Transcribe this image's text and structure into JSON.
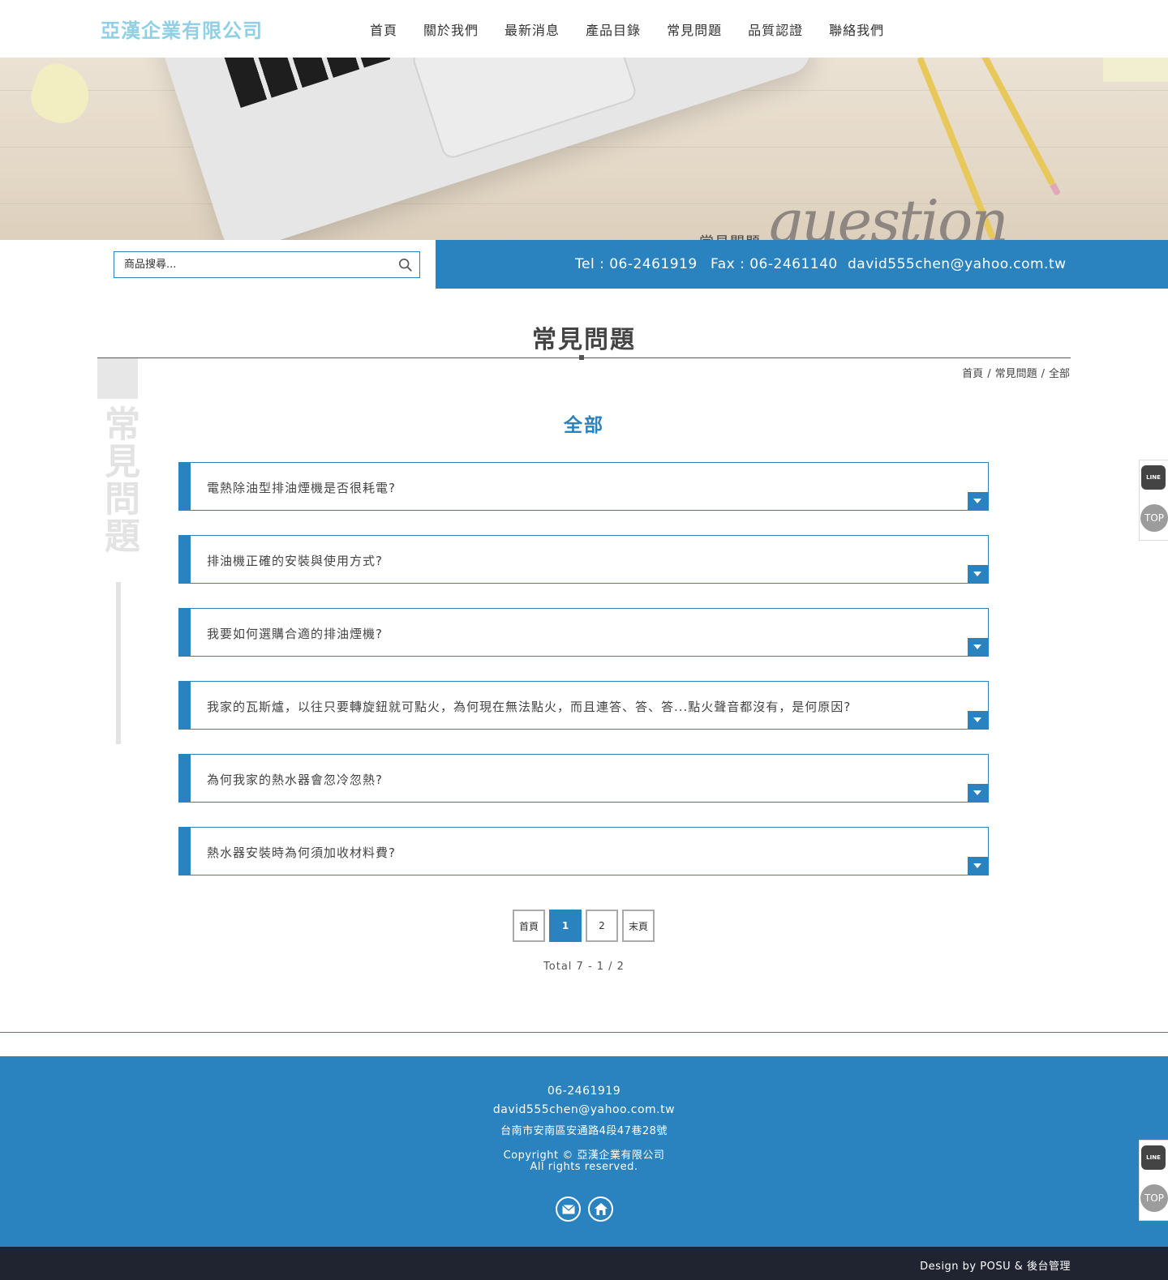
{
  "header": {
    "logo": "亞漢企業有限公司",
    "nav": [
      "首頁",
      "關於我們",
      "最新消息",
      "產品目錄",
      "常見問題",
      "品質認證",
      "聯絡我們"
    ]
  },
  "banner": {
    "title_zh": "常見問題",
    "title_en": "question"
  },
  "search": {
    "placeholder": "商品搜尋..."
  },
  "contact": {
    "tel": "Tel : 06-2461919",
    "fax": "Fax : 06-2461140",
    "email": "david555chen@yahoo.com.tw"
  },
  "page": {
    "title": "常見問題",
    "side_label": "常見問題",
    "breadcrumb": [
      "首頁",
      "常見問題",
      "全部"
    ],
    "breadcrumb_sep": "/",
    "section_title": "全部"
  },
  "faq": [
    "電熱除油型排油煙機是否很耗電?",
    "排油機正確的安裝與使用方式?",
    "我要如何選購合適的排油煙機?",
    "我家的瓦斯爐，以往只要轉旋鈕就可點火，為何現在無法點火，而且連答、答、答...點火聲音都沒有，是何原因?",
    "為何我家的熱水器會忽冷忽熱?",
    "熱水器安裝時為何須加收材料費?"
  ],
  "pagination": {
    "first": "首頁",
    "pages": [
      "1",
      "2"
    ],
    "current": "1",
    "last": "末頁",
    "total": "Total 7 - 1 / 2"
  },
  "footer": {
    "phone": "06-2461919",
    "email": "david555chen@yahoo.com.tw",
    "address": "台南市安南區安通路4段47巷28號",
    "copyright": "Copyright © 亞漢企業有限公司",
    "rights": "All rights reserved.",
    "icons": [
      "mail-icon",
      "home-icon"
    ],
    "design": "Design by POSU & 後台管理"
  },
  "floating": {
    "line_label": "LINE",
    "top_label": "TOP"
  },
  "colors": {
    "brand_blue": "#2a82bf",
    "logo": "#8fd0e6",
    "bottom_bar": "#1f2430"
  }
}
